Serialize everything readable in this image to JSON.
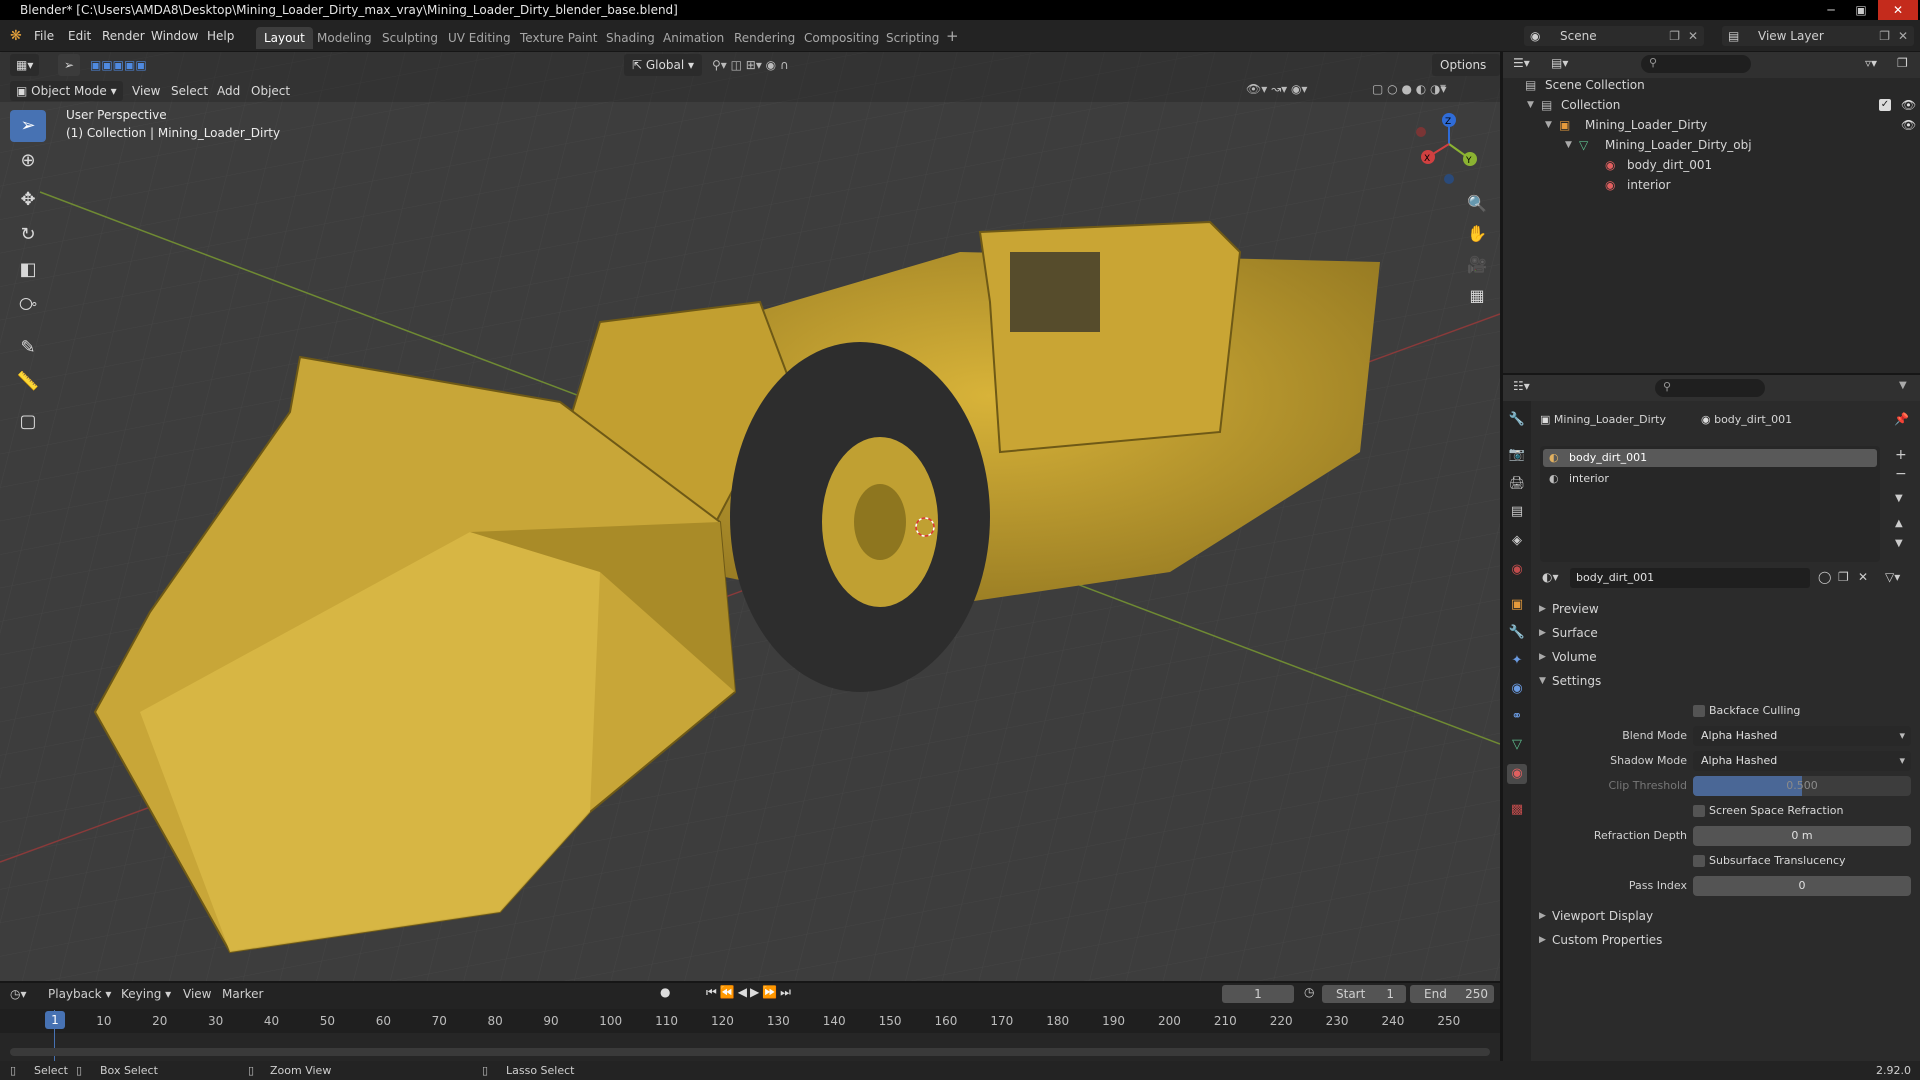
{
  "titlebar": {
    "title": "Blender* [C:\\Users\\AMDA8\\Desktop\\Mining_Loader_Dirty_max_vray\\Mining_Loader_Dirty_blender_base.blend]"
  },
  "menu": [
    "File",
    "Edit",
    "Render",
    "Window",
    "Help"
  ],
  "workspaces": [
    "Layout",
    "Modeling",
    "Sculpting",
    "UV Editing",
    "Texture Paint",
    "Shading",
    "Animation",
    "Rendering",
    "Compositing",
    "Scripting"
  ],
  "active_workspace": "Layout",
  "scene": {
    "scene_name": "Scene",
    "view_layer": "View Layer"
  },
  "viewport_header": {
    "mode": "Object Mode",
    "menus": [
      "View",
      "Select",
      "Add",
      "Object"
    ],
    "orientation": "Global",
    "options_label": "Options"
  },
  "viewport": {
    "view_label": "User Perspective",
    "collection_label": "(1) Collection | Mining_Loader_Dirty",
    "gizmo_axes": [
      "X",
      "Y",
      "Z"
    ]
  },
  "outliner": {
    "items": [
      {
        "label": "Scene Collection",
        "icon": "scene-collection-icon"
      },
      {
        "label": "Collection",
        "icon": "collection-icon"
      },
      {
        "label": "Mining_Loader_Dirty",
        "icon": "object-icon"
      },
      {
        "label": "Mining_Loader_Dirty_obj",
        "icon": "mesh-icon"
      },
      {
        "label": "body_dirt_001",
        "icon": "material-icon"
      },
      {
        "label": "interior",
        "icon": "material-icon"
      }
    ]
  },
  "properties": {
    "breadcrumb_object": "Mining_Loader_Dirty",
    "breadcrumb_material": "body_dirt_001",
    "slots": [
      "body_dirt_001",
      "interior"
    ],
    "active_material": "body_dirt_001",
    "panels_collapsed_top": [
      "Preview",
      "Surface",
      "Volume"
    ],
    "settings_header": "Settings",
    "backface_culling": "Backface Culling",
    "blend_mode_label": "Blend Mode",
    "blend_mode_value": "Alpha Hashed",
    "shadow_mode_label": "Shadow Mode",
    "shadow_mode_value": "Alpha Hashed",
    "clip_threshold_label": "Clip Threshold",
    "clip_threshold_value": "0.500",
    "ssr_label": "Screen Space Refraction",
    "refraction_depth_label": "Refraction Depth",
    "refraction_depth_value": "0 m",
    "subsurface_label": "Subsurface Translucency",
    "pass_index_label": "Pass Index",
    "pass_index_value": "0",
    "panels_collapsed_bottom": [
      "Viewport Display",
      "Custom Properties"
    ]
  },
  "timeline": {
    "menus": [
      "Playback",
      "Keying",
      "View",
      "Marker"
    ],
    "current_frame": "1",
    "start_label": "Start",
    "start_value": "1",
    "end_label": "End",
    "end_value": "250",
    "ticks": [
      "10",
      "20",
      "30",
      "40",
      "50",
      "60",
      "70",
      "80",
      "90",
      "100",
      "110",
      "120",
      "130",
      "140",
      "150",
      "160",
      "170",
      "180",
      "190",
      "200",
      "210",
      "220",
      "230",
      "240",
      "250"
    ],
    "cursor_frame": "1"
  },
  "statusbar": {
    "select": "Select",
    "box_select": "Box Select",
    "zoom_view": "Zoom View",
    "lasso_select": "Lasso Select",
    "version": "2.92.0"
  }
}
